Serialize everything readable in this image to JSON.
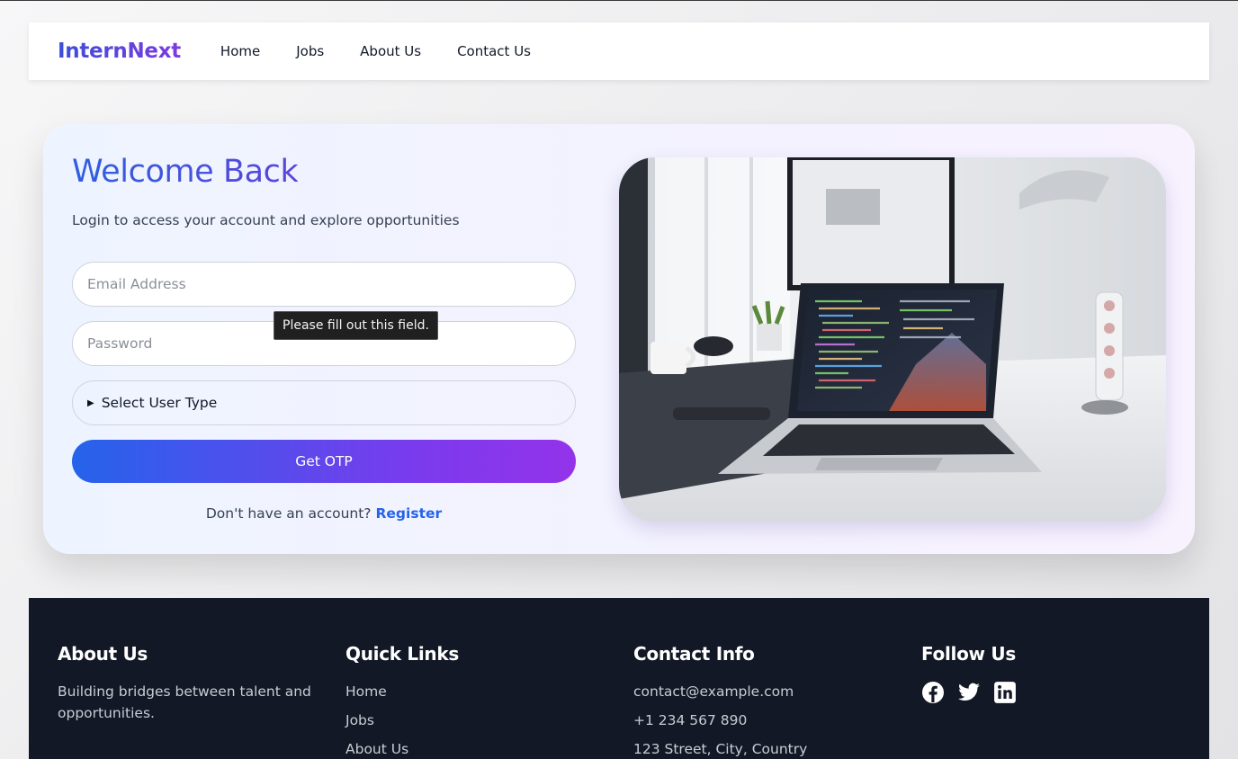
{
  "nav": {
    "logo": "InternNext",
    "links": [
      "Home",
      "Jobs",
      "About Us",
      "Contact Us"
    ]
  },
  "login": {
    "title": "Welcome Back",
    "subtitle": "Login to access your account and explore opportunities",
    "email_placeholder": "Email Address",
    "password_placeholder": "Password",
    "user_type_label": "Select User Type",
    "otp_button": "Get OTP",
    "register_prompt": "Don't have an account?",
    "register_link": "Register",
    "tooltip": "Please fill out this field."
  },
  "footer": {
    "about": {
      "title": "About Us",
      "text": "Building bridges between talent and opportunities."
    },
    "quick_links": {
      "title": "Quick Links",
      "items": [
        "Home",
        "Jobs",
        "About Us"
      ]
    },
    "contact": {
      "title": "Contact Info",
      "email": "contact@example.com",
      "phone": "+1 234 567 890",
      "address": "123 Street, City, Country"
    },
    "follow": {
      "title": "Follow Us",
      "icons": [
        "facebook-icon",
        "twitter-icon",
        "linkedin-icon"
      ]
    }
  },
  "colors": {
    "brand_start": "#3b4fd9",
    "brand_end": "#7e3ae0",
    "button_start": "#2563eb",
    "button_end": "#9333ea",
    "link": "#2563eb",
    "footer_bg": "#121826"
  }
}
